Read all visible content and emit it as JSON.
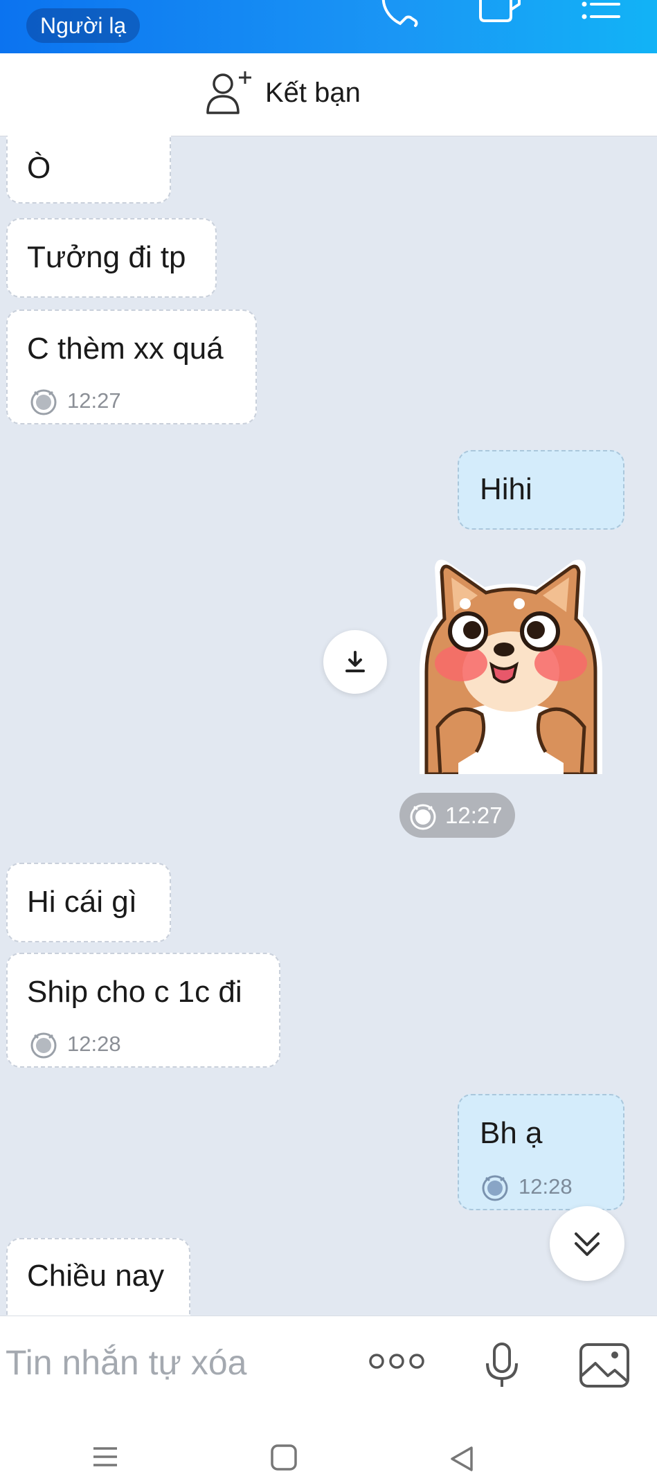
{
  "header": {
    "status_badge": "Người lạ",
    "call_icon": "phone-icon",
    "video_icon": "video-call-icon",
    "menu_icon": "list-menu-icon"
  },
  "add_friend": {
    "icon": "add-person-icon",
    "label": "Kết bạn"
  },
  "messages": [
    {
      "side": "received",
      "text": "Ò"
    },
    {
      "side": "received",
      "text": "Tưởng đi tp"
    },
    {
      "side": "received",
      "text": "C thèm xx quá",
      "time": "12:27"
    },
    {
      "side": "sent",
      "text": "Hihi"
    },
    {
      "side": "sent",
      "type": "sticker",
      "sticker": "shiba-dog-blushing",
      "time": "12:27"
    },
    {
      "side": "received",
      "text": "Hi cái gì"
    },
    {
      "side": "received",
      "text": "Ship cho c 1c đi",
      "time": "12:28"
    },
    {
      "side": "sent",
      "text": "Bh ạ",
      "time": "12:28"
    },
    {
      "side": "received",
      "text": "Chiều nay"
    }
  ],
  "composer": {
    "placeholder": "Tin nhắn tự xóa",
    "more_icon": "more-dots-icon",
    "mic_icon": "microphone-icon",
    "image_icon": "image-icon"
  },
  "colors": {
    "header_start": "#0b73f0",
    "header_end": "#12b3f6",
    "chat_bg": "#e2e8f1",
    "sent_bubble": "#d4ecfb",
    "received_bubble": "#ffffff"
  }
}
